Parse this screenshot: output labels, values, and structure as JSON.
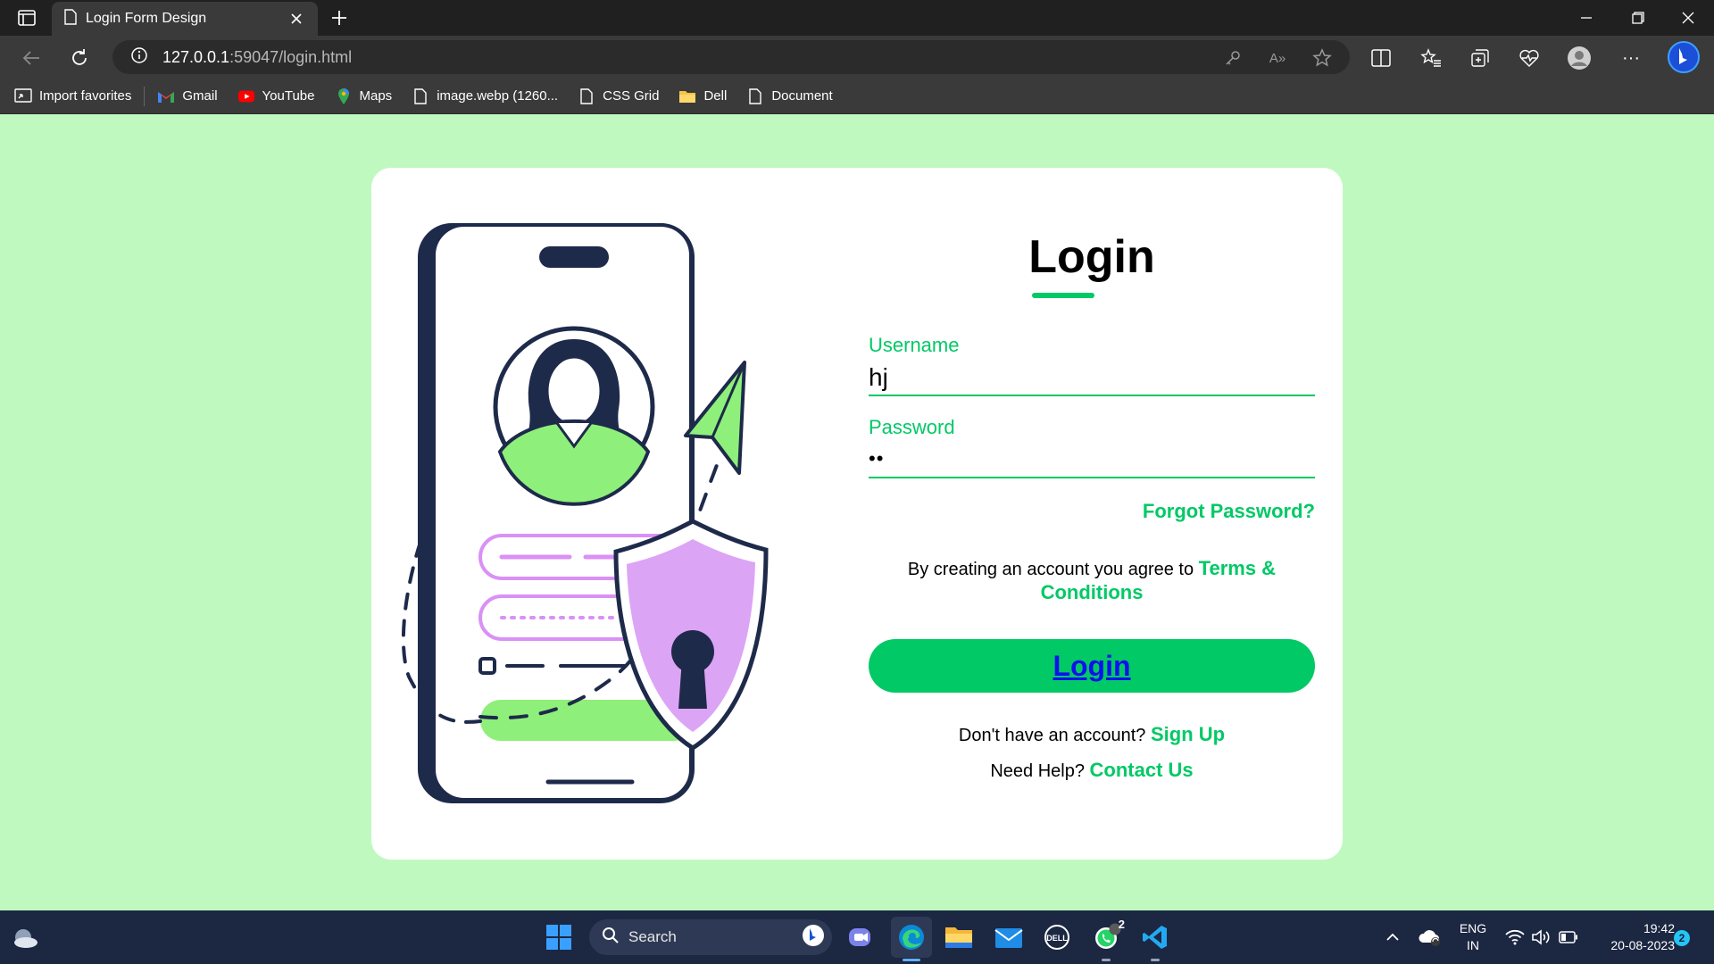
{
  "browser": {
    "tab_title": "Login Form Design",
    "url_host": "127.0.0.1",
    "url_path": ":59047/login.html"
  },
  "favorites": [
    {
      "label": "Import favorites",
      "icon": "import-icon"
    },
    {
      "label": "Gmail",
      "icon": "gmail-icon"
    },
    {
      "label": "YouTube",
      "icon": "youtube-icon"
    },
    {
      "label": "Maps",
      "icon": "maps-icon"
    },
    {
      "label": "image.webp (1260...",
      "icon": "page-icon"
    },
    {
      "label": "CSS Grid",
      "icon": "page-icon"
    },
    {
      "label": "Dell",
      "icon": "folder-icon"
    },
    {
      "label": "Document",
      "icon": "page-icon"
    }
  ],
  "form": {
    "title": "Login",
    "username_label": "Username",
    "username_value": "hj",
    "password_label": "Password",
    "password_value": "••",
    "forgot": "Forgot Password?",
    "terms_prefix": "By creating an account you agree to ",
    "terms_link": "Terms & Conditions",
    "login_button": "Login",
    "signup_prefix": "Don't have an account? ",
    "signup_link": "Sign Up",
    "help_prefix": "Need Help? ",
    "help_link": "Contact Us"
  },
  "taskbar": {
    "search_placeholder": "Search",
    "lang_top": "ENG",
    "lang_bottom": "IN",
    "time": "19:42",
    "date": "20-08-2023",
    "notifications": "2",
    "whatsapp_badge": "2"
  },
  "colors": {
    "page_bg": "#bff9c0",
    "accent": "#00c965",
    "link": "#1010ee"
  }
}
